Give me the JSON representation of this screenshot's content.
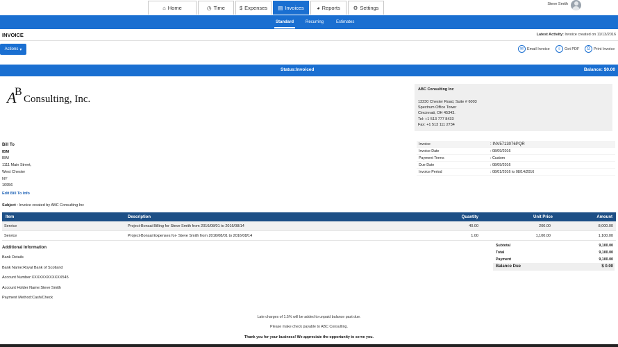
{
  "nav": {
    "tabs": [
      {
        "label": "Home",
        "icon": "home-icon",
        "glyph": "⌂"
      },
      {
        "label": "Time",
        "icon": "clock-icon",
        "glyph": "◷"
      },
      {
        "label": "Expenses",
        "icon": "dollar-icon",
        "glyph": "$"
      },
      {
        "label": "Invoices",
        "icon": "invoice-icon",
        "glyph": "▤"
      },
      {
        "label": "Reports",
        "icon": "pie-chart-icon",
        "glyph": "◕"
      },
      {
        "label": "Settings",
        "icon": "gear-icon",
        "glyph": "⚙"
      }
    ],
    "active_tab": "Invoices",
    "user_name": "Steve Smith"
  },
  "subnav": {
    "tabs": [
      "Standard",
      "Recurring",
      "Estimates"
    ],
    "active": "Standard"
  },
  "page": {
    "title": "INVOICE",
    "latest_label": "Latest Activity:",
    "latest_value": "Invoice created on 11/13/2016"
  },
  "toolbar": {
    "actions_label": "Actions",
    "email_label": "Email Invoice",
    "pdf_label": "Get PDF",
    "print_label": "Print Invoice"
  },
  "status": {
    "status_text": "Status:Invoiced",
    "balance_text": "Balance: $0.00"
  },
  "logo": {
    "letters_a": "A",
    "letters_b": "B",
    "text": "Consulting, Inc."
  },
  "company": {
    "name": "ABC Consulting Inc",
    "lines": [
      "13230 Chester Road, Suite # 6003",
      "Spectrum Office Tower",
      "Cincinnati, OH 45343.",
      "Tel: +1 513 777 8433",
      "Fax: +1 513 111 2734"
    ]
  },
  "bill_to": {
    "heading": "Bill To",
    "lines": [
      "IBM",
      "IBM",
      "1111 Main Street,",
      "West Chester",
      "NY",
      "10956"
    ],
    "edit_link": "Edit Bill To Info"
  },
  "subject": {
    "label": "Subject",
    "value": ": Invoice created by ABC Consulting Inc"
  },
  "meta": [
    {
      "k": "Invoice",
      "v": ": INV5713076PQR"
    },
    {
      "k": "Invoice Date",
      "v": ": 08/09/2016"
    },
    {
      "k": "Payment Terms",
      "v": ": Custom"
    },
    {
      "k": "Due Date",
      "v": ": 08/09/2016"
    },
    {
      "k": "Invoice Period",
      "v": ": 08/01/2016 to 08/14/2016"
    }
  ],
  "items": {
    "headers": {
      "item": "Item",
      "description": "Description",
      "quantity": "Quantity",
      "unit_price": "Unit Price",
      "amount": "Amount"
    },
    "rows": [
      {
        "item": "Service",
        "description": "Project-Bonsai Billing for Steve Smith from 2016/08/01 to 2016/08/14",
        "quantity": "40.00",
        "unit_price": "200.00",
        "amount": "8,000.00"
      },
      {
        "item": "Service",
        "description": "Project-Bonsai Expenses for- Steve Smith from 2016/08/01 to 2016/08/14",
        "quantity": "1.00",
        "unit_price": "1,100.00",
        "amount": "1,100.00"
      }
    ]
  },
  "additional": {
    "heading": "Additional Information",
    "lines": [
      "Bank Details",
      "Bank Name:Royal Bank of Scotland",
      "Account Number:XXXXXXXXXXXX545",
      "Account Holder Name:Steve Smith",
      "Payment Method:Cash/Check"
    ]
  },
  "totals": [
    {
      "k": "Subtotal",
      "v": "9,100.00"
    },
    {
      "k": "Total",
      "v": "9,100.00"
    },
    {
      "k": "Payment",
      "v": "9,100.00"
    },
    {
      "k": "Balance Due",
      "v": "$ 0.00"
    }
  ],
  "footer": {
    "line1": "Late charges of 1.5% will be added to unpaid balance past due.",
    "line2": "Please make check payable to ABC Consulting.",
    "line3": "Thank you for your business! We appreciate the opportunity to serve you."
  },
  "colors": {
    "primary": "#1a6fd1",
    "table_header": "#1d4f86"
  }
}
